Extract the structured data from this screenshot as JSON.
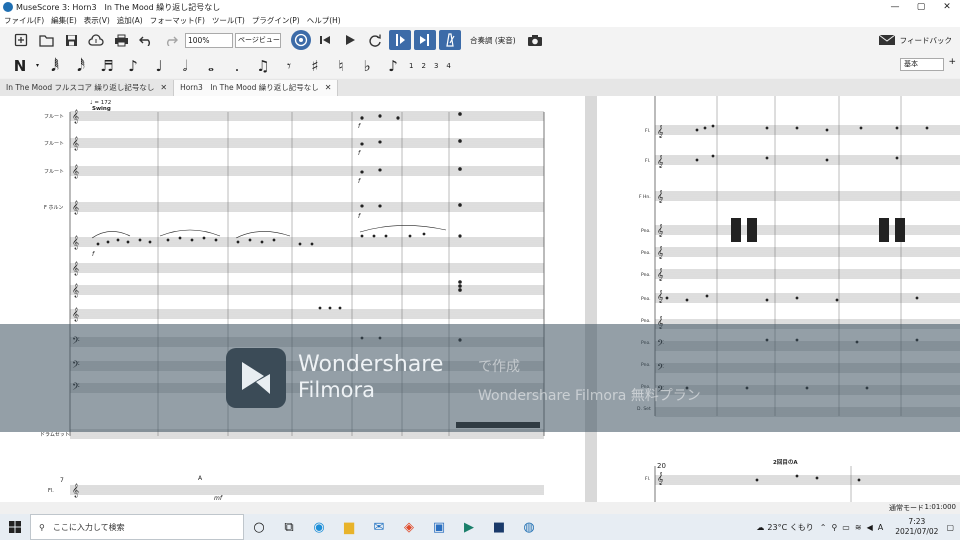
{
  "window": {
    "title": "MuseScore 3: Horn3　In The Mood 繰り返し記号なし",
    "controls": [
      "—",
      "▢",
      "✕"
    ]
  },
  "menu": [
    "ファイル(F)",
    "編集(E)",
    "表示(V)",
    "追加(A)",
    "フォーマット(F)",
    "ツール(T)",
    "プラグイン(P)",
    "ヘルプ(H)"
  ],
  "toolbar": {
    "zoom_value": "100%",
    "view_mode": "ページビュー",
    "concert_pitch": "合奏調 (実音)",
    "feedback": "フィードバック"
  },
  "note_input": {
    "voices": [
      "1",
      "2",
      "3",
      "4"
    ],
    "workspace": "基本"
  },
  "tabs": [
    {
      "label": "In The Mood フルスコア 繰り返し記号なし"
    },
    {
      "label": "Horn3　In The Mood 繰り返し記号なし"
    }
  ],
  "score": {
    "tempo": "♩ = 172",
    "style": "Swing",
    "instr_flute": "フルート",
    "instr_horn": "F ホルン",
    "instr_drums": "ドラムセット",
    "instr_fl": "Fl.",
    "instr_fhn": "F Hn.",
    "instr_pno": "Pno.",
    "instr_dset": "D. Set",
    "measure_7": "7",
    "measure_20": "20",
    "rehearsal_a": "A",
    "second_time_a": "2回目のA",
    "dyn_f": "f",
    "dyn_mf": "mf"
  },
  "watermark": {
    "brand_line1": "Wondershare",
    "brand_line2": "Filmora",
    "made_with": "で作成",
    "plan_text": "Wondershare Filmora 無料プラン"
  },
  "status": {
    "mode": "通常モード",
    "time": "1:01:000"
  },
  "taskbar": {
    "search_placeholder": "ここに入力して検索",
    "weather": "23°C くもり",
    "clock_time": "7:23",
    "clock_date": "2021/07/02"
  }
}
